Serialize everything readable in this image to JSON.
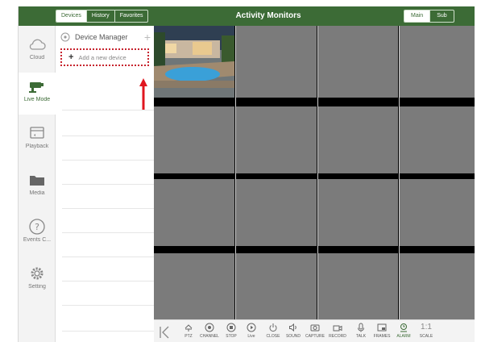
{
  "topbar": {
    "tabs": [
      "Devices",
      "History",
      "Favorites"
    ],
    "active_tab": "Devices",
    "title": "Activity Monitors",
    "stream_tabs": [
      "Main",
      "Sub"
    ],
    "active_stream": "Main",
    "accent_color": "#3c6b36"
  },
  "sidebar": {
    "items": [
      {
        "label": "Cloud",
        "icon": "cloud-icon"
      },
      {
        "label": "Live Mode",
        "icon": "camera-icon"
      },
      {
        "label": "Playback",
        "icon": "playback-icon"
      },
      {
        "label": "Media",
        "icon": "folder-icon"
      },
      {
        "label": "Events C...",
        "icon": "question-icon"
      },
      {
        "label": "Setting",
        "icon": "gear-icon"
      }
    ],
    "active": "Live Mode"
  },
  "device_panel": {
    "title": "Device Manager",
    "add_label": "Add a new device",
    "highlight_color": "#c7242e"
  },
  "toolbar": {
    "items": [
      {
        "label": "PTZ",
        "icon": "ptz-icon"
      },
      {
        "label": "CHANNEL",
        "icon": "channel-icon"
      },
      {
        "label": "STOP",
        "icon": "stop-icon"
      },
      {
        "label": "Live",
        "icon": "play-icon"
      },
      {
        "label": "CLOSE",
        "icon": "power-icon"
      },
      {
        "label": "SOUND",
        "icon": "speaker-icon"
      },
      {
        "label": "CAPTURE",
        "icon": "capture-icon"
      },
      {
        "label": "RECORD",
        "icon": "record-icon"
      },
      {
        "label": "TALK",
        "icon": "mic-icon"
      },
      {
        "label": "FRAMES",
        "icon": "frames-icon"
      },
      {
        "label": "ALARM",
        "icon": "alarm-icon"
      },
      {
        "label": "SCALE",
        "icon": "scale-icon",
        "ratio": "1:1"
      }
    ]
  }
}
